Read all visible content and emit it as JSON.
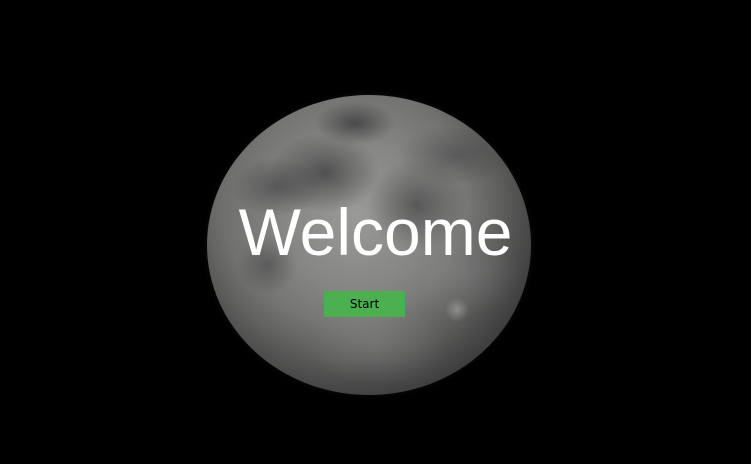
{
  "page": {
    "heading": "Welcome",
    "background_image": "moon-photo",
    "colors": {
      "background": "#000000",
      "heading_text": "#ffffff",
      "start_button_bg": "#4caf50",
      "start_button_text": "#000000"
    }
  },
  "actions": {
    "start_label": "Start"
  }
}
